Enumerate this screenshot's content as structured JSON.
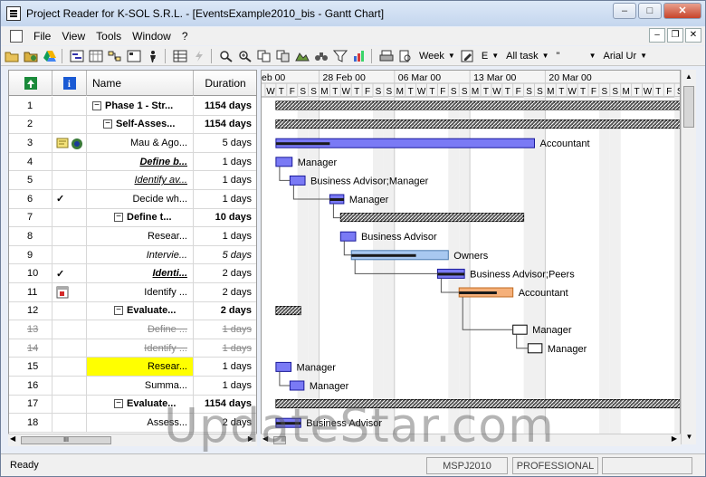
{
  "window": {
    "title": "Project Reader for K-SOL S.R.L. - [EventsExample2010_bis - Gantt Chart]",
    "minimize": "–",
    "maximize": "□",
    "close": "✕"
  },
  "menu": {
    "items": [
      "File",
      "View",
      "Tools",
      "Window",
      "?"
    ]
  },
  "toolbar": {
    "timescale": "Week",
    "view_short": "E",
    "filter": "All task",
    "font": "Arial Ur"
  },
  "grid": {
    "headers": {
      "id_icon": "↑",
      "info_icon": "i",
      "name": "Name",
      "duration": "Duration"
    },
    "rows": [
      {
        "id": "1",
        "indicator": "",
        "name": "Phase 1 - Str...",
        "duration": "1154 days",
        "level": 0,
        "summary": true,
        "bold": true
      },
      {
        "id": "2",
        "indicator": "",
        "name": "Self-Asses...",
        "duration": "1154 days",
        "level": 1,
        "summary": true,
        "bold": true
      },
      {
        "id": "3",
        "indicator": "notes",
        "name": "Mau & Ago...",
        "duration": "5 days",
        "level": 2
      },
      {
        "id": "4",
        "indicator": "",
        "name": "Define b...",
        "duration": "1 days",
        "level": 2,
        "bold": true,
        "italic": true,
        "underline": true
      },
      {
        "id": "5",
        "indicator": "",
        "name": "Identify av...",
        "duration": "1 days",
        "level": 2,
        "italic": true,
        "underline": true
      },
      {
        "id": "6",
        "indicator": "check",
        "name": "Decide wh...",
        "duration": "1 days",
        "level": 2
      },
      {
        "id": "7",
        "indicator": "",
        "name": "Define t...",
        "duration": "10 days",
        "level": 2,
        "summary": true,
        "bold": true
      },
      {
        "id": "8",
        "indicator": "",
        "name": "Resear...",
        "duration": "1 days",
        "level": 3
      },
      {
        "id": "9",
        "indicator": "",
        "name": "Intervie...",
        "duration": "5 days",
        "level": 3,
        "italic": true,
        "italicDuration": true
      },
      {
        "id": "10",
        "indicator": "check",
        "name": "Identi...",
        "duration": "2 days",
        "level": 3,
        "bold": true,
        "italic": true,
        "underline": true
      },
      {
        "id": "11",
        "indicator": "calendar",
        "name": "Identify ...",
        "duration": "2 days",
        "level": 3
      },
      {
        "id": "12",
        "indicator": "",
        "name": "Evaluate...",
        "duration": "2 days",
        "level": 2,
        "summary": true,
        "bold": true
      },
      {
        "id": "13",
        "indicator": "",
        "name": "Define ...",
        "duration": "1 days",
        "level": 3,
        "strike": true
      },
      {
        "id": "14",
        "indicator": "",
        "name": "Identify ...",
        "duration": "1 days",
        "level": 3,
        "strike": true
      },
      {
        "id": "15",
        "indicator": "",
        "name": "Resear...",
        "duration": "1 days",
        "level": 3,
        "highlight": true
      },
      {
        "id": "16",
        "indicator": "",
        "name": "Summa...",
        "duration": "1 days",
        "level": 3
      },
      {
        "id": "17",
        "indicator": "",
        "name": "Evaluate...",
        "duration": "1154 days",
        "level": 2,
        "summary": true,
        "bold": true
      },
      {
        "id": "18",
        "indicator": "",
        "name": "Assess...",
        "duration": "2 days",
        "level": 3
      }
    ]
  },
  "gantt": {
    "weeks": [
      "eb 00",
      "28 Feb 00",
      "06 Mar 00",
      "13 Mar 00",
      "20 Mar 00"
    ],
    "days": [
      "W",
      "T",
      "F",
      "S",
      "S",
      "M",
      "T",
      "W",
      "T",
      "F",
      "S",
      "S",
      "M",
      "T",
      "W",
      "T",
      "F",
      "S",
      "S",
      "M",
      "T",
      "W",
      "T",
      "F",
      "S",
      "S",
      "M",
      "T",
      "W",
      "T",
      "F",
      "S",
      "S",
      "M",
      "T",
      "W",
      "T",
      "F",
      "S"
    ],
    "labels": [
      {
        "row": 2,
        "text": "Accountant"
      },
      {
        "row": 3,
        "text": "Manager"
      },
      {
        "row": 4,
        "text": "Business Advisor;Manager"
      },
      {
        "row": 5,
        "text": "Manager"
      },
      {
        "row": 7,
        "text": "Business Advisor"
      },
      {
        "row": 8,
        "text": "Owners"
      },
      {
        "row": 9,
        "text": "Business Advisor;Peers"
      },
      {
        "row": 10,
        "text": "Accountant"
      },
      {
        "row": 12,
        "text": "Manager"
      },
      {
        "row": 13,
        "text": "Manager"
      },
      {
        "row": 14,
        "text": "Manager"
      },
      {
        "row": 15,
        "text": "Manager"
      },
      {
        "row": 17,
        "text": "Business Advisor"
      }
    ],
    "colors": {
      "task": "#7a7af5",
      "task_border": "#1a1a9a",
      "critical": "#f5b07a",
      "summary": "#555555",
      "progress": "#1a1a1a",
      "weekend": "#f0f0f0"
    }
  },
  "scroll": {
    "thumb_glyph": "III"
  },
  "status": {
    "ready": "Ready",
    "version": "MSPJ2010",
    "edition": "PROFESSIONAL"
  },
  "watermark": "UpdateStar.com"
}
